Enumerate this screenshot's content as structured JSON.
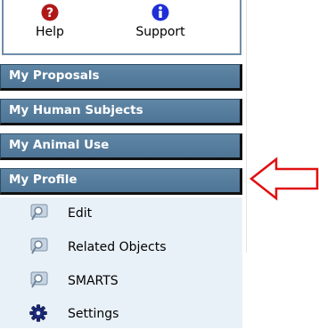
{
  "help_box": {
    "help_label": "Help",
    "support_label": "Support",
    "help_icon_color": "#b01818",
    "support_icon_color": "#1d2fd8"
  },
  "nav": {
    "my_proposals": "My Proposals",
    "my_human_subjects": "My Human Subjects",
    "my_animal_use": "My Animal Use",
    "my_profile": "My Profile"
  },
  "profile_menu": {
    "edit": "Edit",
    "related_objects": "Related Objects",
    "smarts": "SMARTS",
    "settings": "Settings"
  },
  "annotation": {
    "arrow_color": "#e01010"
  }
}
